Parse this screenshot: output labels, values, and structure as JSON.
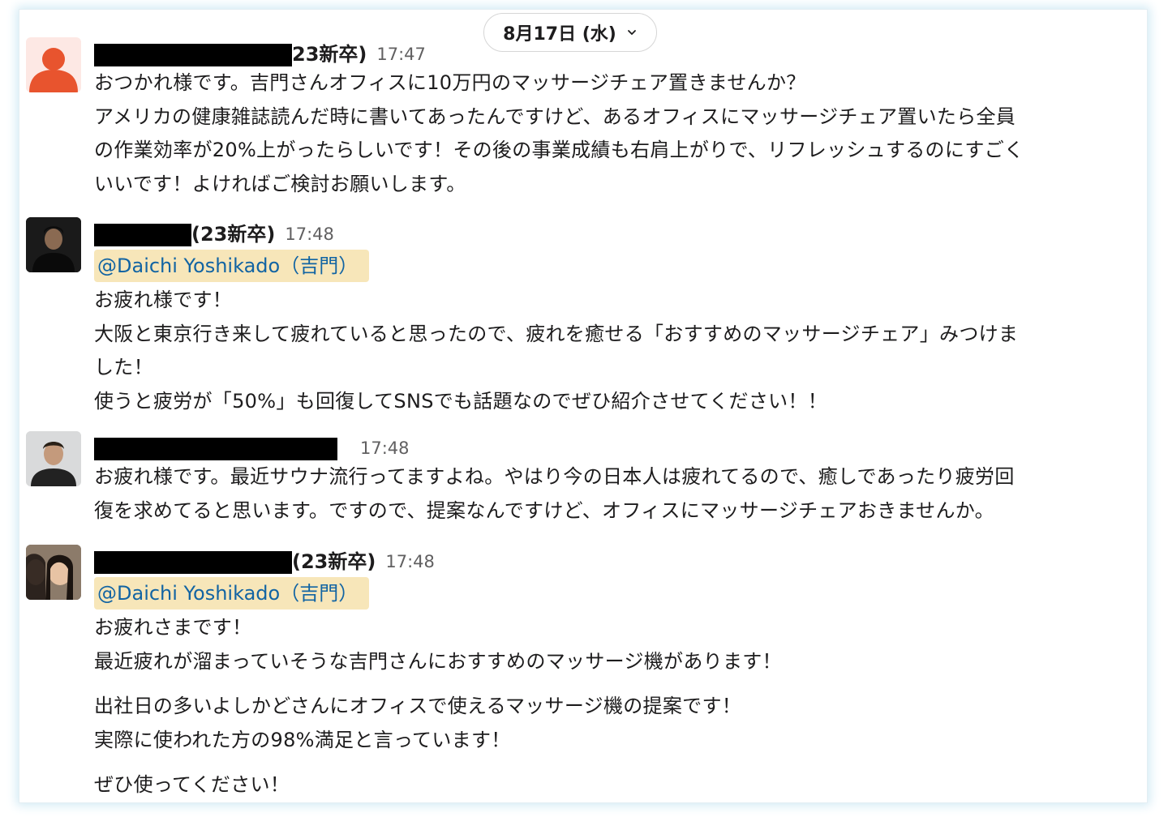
{
  "date_pill": {
    "label": "8月17日 (水)"
  },
  "messages": [
    {
      "suffix": "23新卒)",
      "time": "17:47",
      "mention": null,
      "lines": [
        "おつかれ様です。吉門さんオフィスに10万円のマッサージチェア置きませんか？",
        "アメリカの健康雑誌読んだ時に書いてあったんですけど、あるオフィスにマッサージチェア置いたら全員",
        "の作業効率が20%上がったらしいです！その後の事業成績も右肩上がりで、リフレッシュするのにすごく",
        "いいです！よければご検討お願いします。"
      ]
    },
    {
      "suffix": "(23新卒)",
      "time": "17:48",
      "mention": "@Daichi Yoshikado（吉門）",
      "lines": [
        "お疲れ様です！",
        "大阪と東京行き来して疲れていると思ったので、疲れを癒せる「おすすめのマッサージチェア」みつけま",
        "した！",
        "使うと疲労が「50%」も回復してSNSでも話題なのでぜひ紹介させてください！！"
      ]
    },
    {
      "suffix": "",
      "time": "17:48",
      "mention": null,
      "lines": [
        "お疲れ様です。最近サウナ流行ってますよね。やはり今の日本人は疲れてるので、癒しであったり疲労回",
        "復を求めてると思います。ですので、提案なんですけど、オフィスにマッサージチェアおきませんか。"
      ]
    },
    {
      "suffix": "(23新卒)",
      "time": "17:48",
      "mention": "@Daichi Yoshikado（吉門）",
      "lines": [
        "お疲れさまです！",
        "最近疲れが溜まっていそうな吉門さんにおすすめのマッサージ機があります！",
        "",
        "出社日の多いよしかどさんにオフィスで使えるマッサージ機の提案です！",
        "実際に使われた方の98%満足と言っています！",
        "",
        "ぜひ使ってください！"
      ]
    }
  ]
}
